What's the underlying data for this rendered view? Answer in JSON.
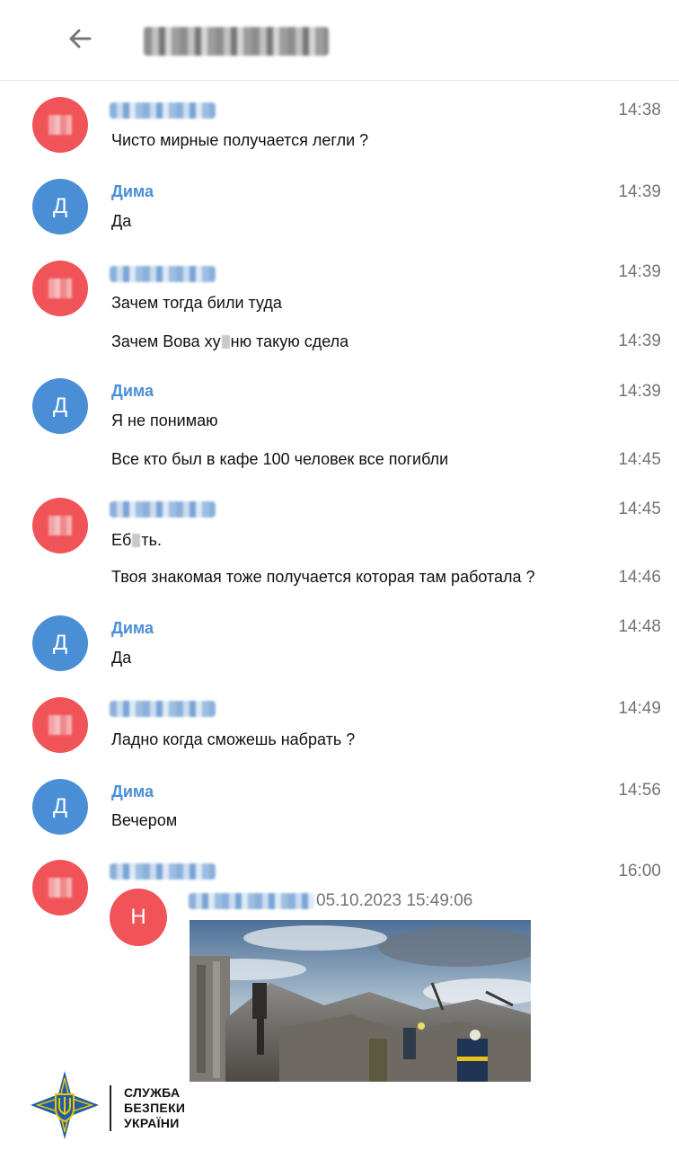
{
  "header": {
    "back_icon": "arrow-left-icon",
    "chat_name_blurred": true
  },
  "messages": [
    {
      "sender": "",
      "sender_blurred": true,
      "avatar_letter": "",
      "avatar_color": "#f05458",
      "lines": [
        {
          "text": "Чисто мирные получается легли ?",
          "time": "14:38"
        }
      ]
    },
    {
      "sender": "Дима",
      "sender_blurred": false,
      "avatar_letter": "Д",
      "avatar_color": "#4a8fd6",
      "lines": [
        {
          "text": "Да",
          "time": "14:39"
        }
      ]
    },
    {
      "sender": "",
      "sender_blurred": true,
      "avatar_letter": "",
      "avatar_color": "#f05458",
      "lines": [
        {
          "text": "Зачем тогда били туда",
          "time": "14:39"
        },
        {
          "text_before": "Зачем Вова ху",
          "text_after": "ню такую сдела",
          "time": "14:39"
        }
      ]
    },
    {
      "sender": "Дима",
      "sender_blurred": false,
      "avatar_letter": "Д",
      "avatar_color": "#4a8fd6",
      "lines": [
        {
          "text": "Я не понимаю",
          "time": "14:39"
        },
        {
          "text": "Все кто был в кафе 100 человек все погибли",
          "time": "14:45"
        }
      ]
    },
    {
      "sender": "",
      "sender_blurred": true,
      "avatar_letter": "",
      "avatar_color": "#f05458",
      "lines": [
        {
          "text_before": "Еб",
          "text_after": "ть.",
          "time": "14:45"
        },
        {
          "text": "Твоя знакомая тоже получается которая там работала ?",
          "time": "14:46"
        }
      ]
    },
    {
      "sender": "Дима",
      "sender_blurred": false,
      "avatar_letter": "Д",
      "avatar_color": "#4a8fd6",
      "lines": [
        {
          "text": "Да",
          "time": "14:48"
        }
      ]
    },
    {
      "sender": "",
      "sender_blurred": true,
      "avatar_letter": "",
      "avatar_color": "#f05458",
      "lines": [
        {
          "text": "Ладно когда сможешь набрать ?",
          "time": "14:49"
        }
      ]
    },
    {
      "sender": "Дима",
      "sender_blurred": false,
      "avatar_letter": "Д",
      "avatar_color": "#4a8fd6",
      "lines": [
        {
          "text": "Вечером",
          "time": "14:56"
        }
      ]
    },
    {
      "sender": "",
      "sender_blurred": true,
      "avatar_letter": "",
      "avatar_color": "#f05458",
      "lines": [
        {
          "text": "",
          "time": "16:00"
        }
      ]
    }
  ],
  "forwarded": {
    "avatar_letter": "Н",
    "avatar_color": "#f05458",
    "sender_blurred": true,
    "datetime": "05.10.2023 15:49:06",
    "photo": "destroyed-building-rescue-photo"
  },
  "watermark": {
    "line1": "СЛУЖБА",
    "line2": "БЕЗПЕКИ",
    "line3": "УКРАЇНИ",
    "emblem": "trident-emblem-icon",
    "colors": {
      "blue": "#1f5fa8",
      "gold": "#f2c300"
    }
  }
}
